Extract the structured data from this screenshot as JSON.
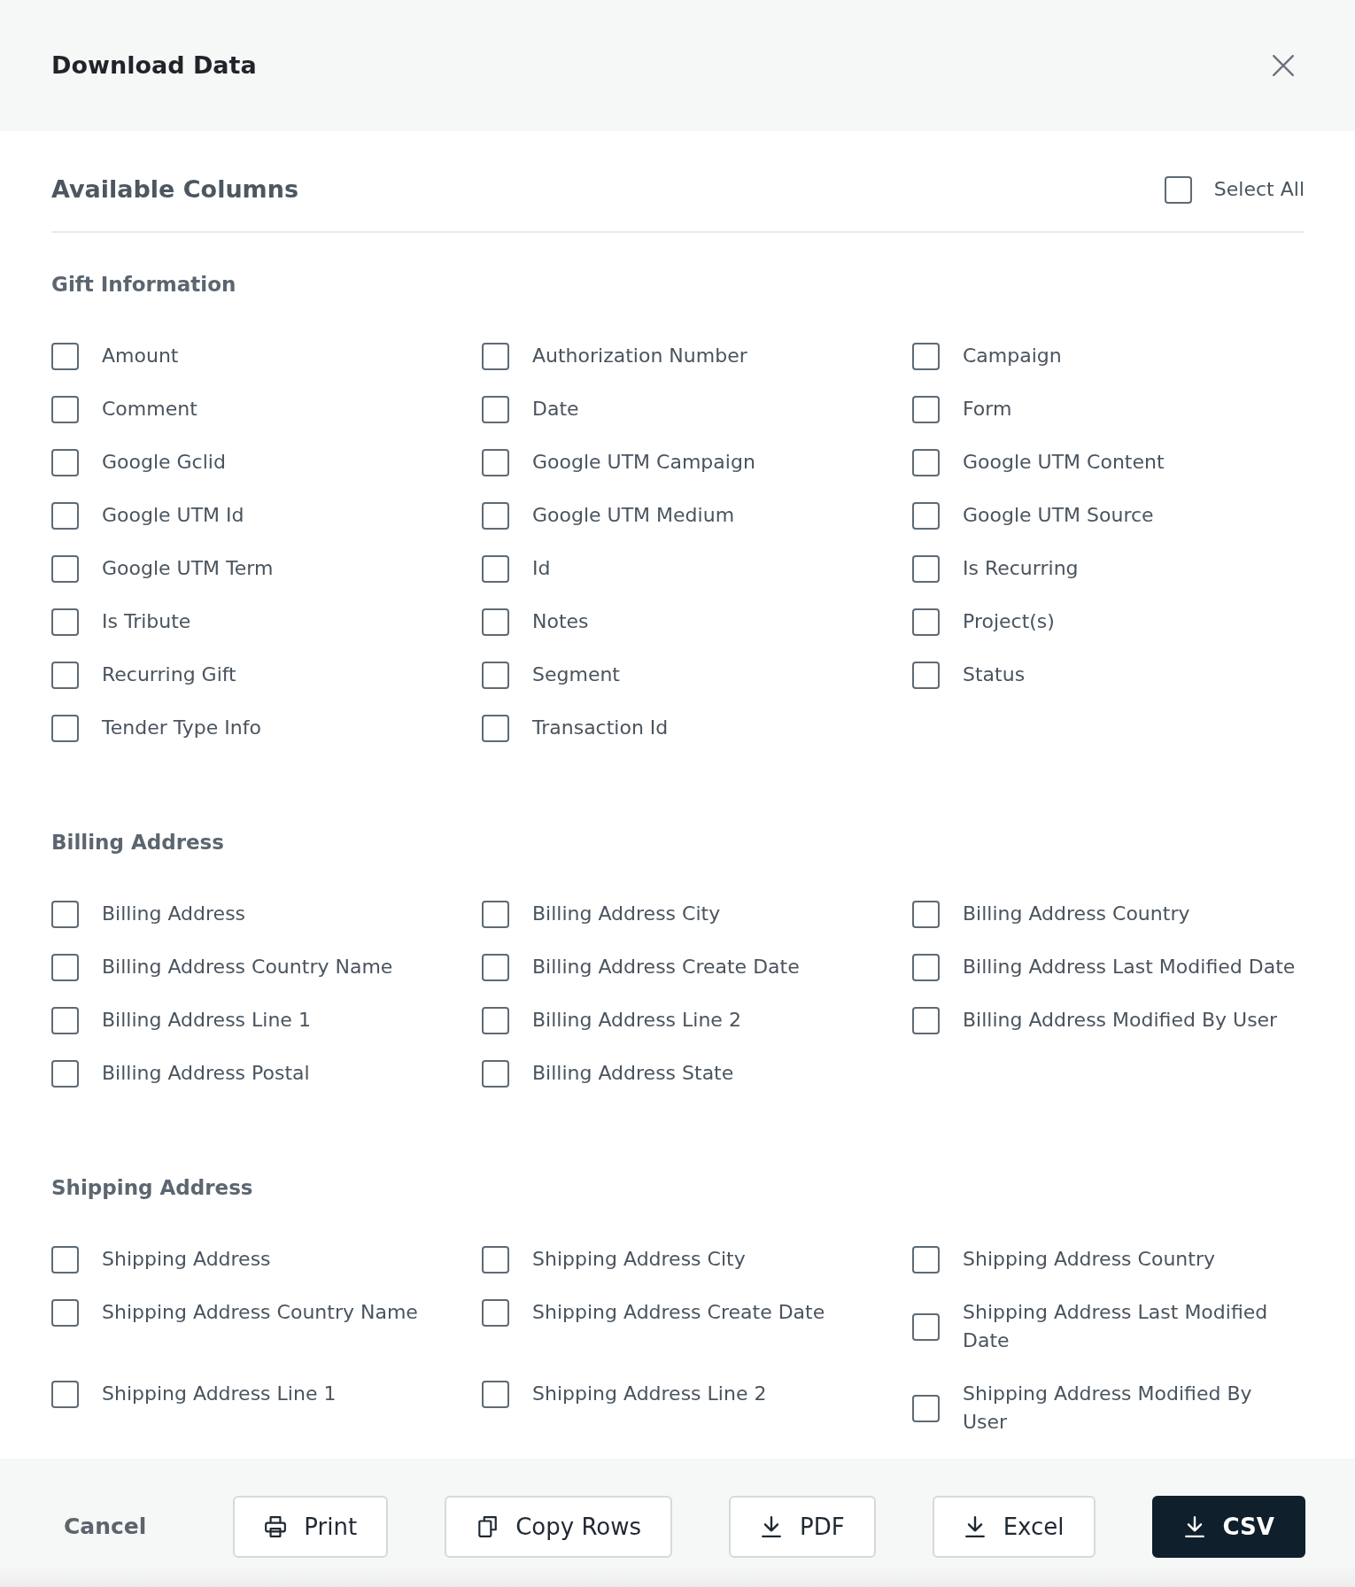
{
  "dialog": {
    "title": "Download Data"
  },
  "columns_panel": {
    "title": "Available Columns",
    "select_all": {
      "label": "Select All",
      "checked": false
    }
  },
  "sections": [
    {
      "title": "Gift Information",
      "options": [
        {
          "label": "Amount",
          "checked": false
        },
        {
          "label": "Authorization Number",
          "checked": false
        },
        {
          "label": "Campaign",
          "checked": false
        },
        {
          "label": "Comment",
          "checked": false
        },
        {
          "label": "Date",
          "checked": false
        },
        {
          "label": "Form",
          "checked": false
        },
        {
          "label": "Google Gclid",
          "checked": false
        },
        {
          "label": "Google UTM Campaign",
          "checked": false
        },
        {
          "label": "Google UTM Content",
          "checked": false
        },
        {
          "label": "Google UTM Id",
          "checked": false
        },
        {
          "label": "Google UTM Medium",
          "checked": false
        },
        {
          "label": "Google UTM Source",
          "checked": false
        },
        {
          "label": "Google UTM Term",
          "checked": false
        },
        {
          "label": "Id",
          "checked": false
        },
        {
          "label": "Is Recurring",
          "checked": false
        },
        {
          "label": "Is Tribute",
          "checked": false
        },
        {
          "label": "Notes",
          "checked": false
        },
        {
          "label": "Project(s)",
          "checked": false
        },
        {
          "label": "Recurring Gift",
          "checked": false
        },
        {
          "label": "Segment",
          "checked": false
        },
        {
          "label": "Status",
          "checked": false
        },
        {
          "label": "Tender Type Info",
          "checked": false
        },
        {
          "label": "Transaction Id",
          "checked": false
        }
      ]
    },
    {
      "title": "Billing Address",
      "options": [
        {
          "label": "Billing Address",
          "checked": false
        },
        {
          "label": "Billing Address City",
          "checked": false
        },
        {
          "label": "Billing Address Country",
          "checked": false
        },
        {
          "label": "Billing Address Country Name",
          "checked": false
        },
        {
          "label": "Billing Address Create Date",
          "checked": false
        },
        {
          "label": "Billing Address Last Modified Date",
          "checked": false
        },
        {
          "label": "Billing Address Line 1",
          "checked": false
        },
        {
          "label": "Billing Address Line 2",
          "checked": false
        },
        {
          "label": "Billing Address Modified By User",
          "checked": false
        },
        {
          "label": "Billing Address Postal",
          "checked": false
        },
        {
          "label": "Billing Address State",
          "checked": false
        }
      ]
    },
    {
      "title": "Shipping Address",
      "options": [
        {
          "label": "Shipping Address",
          "checked": false
        },
        {
          "label": "Shipping Address City",
          "checked": false
        },
        {
          "label": "Shipping Address Country",
          "checked": false
        },
        {
          "label": "Shipping Address Country Name",
          "checked": false
        },
        {
          "label": "Shipping Address Create Date",
          "checked": false
        },
        {
          "label": "Shipping Address Last Modified Date",
          "checked": false
        },
        {
          "label": "Shipping Address Line 1",
          "checked": false
        },
        {
          "label": "Shipping Address Line 2",
          "checked": false
        },
        {
          "label": "Shipping Address Modified By User",
          "checked": false
        }
      ]
    }
  ],
  "footer": {
    "buttons": [
      {
        "label": "Cancel",
        "kind": "cancel"
      },
      {
        "label": "Print",
        "kind": "print"
      },
      {
        "label": "Copy Rows",
        "kind": "copy"
      },
      {
        "label": "PDF",
        "kind": "download"
      },
      {
        "label": "Excel",
        "kind": "download"
      },
      {
        "label": "CSV",
        "kind": "primary"
      }
    ]
  }
}
